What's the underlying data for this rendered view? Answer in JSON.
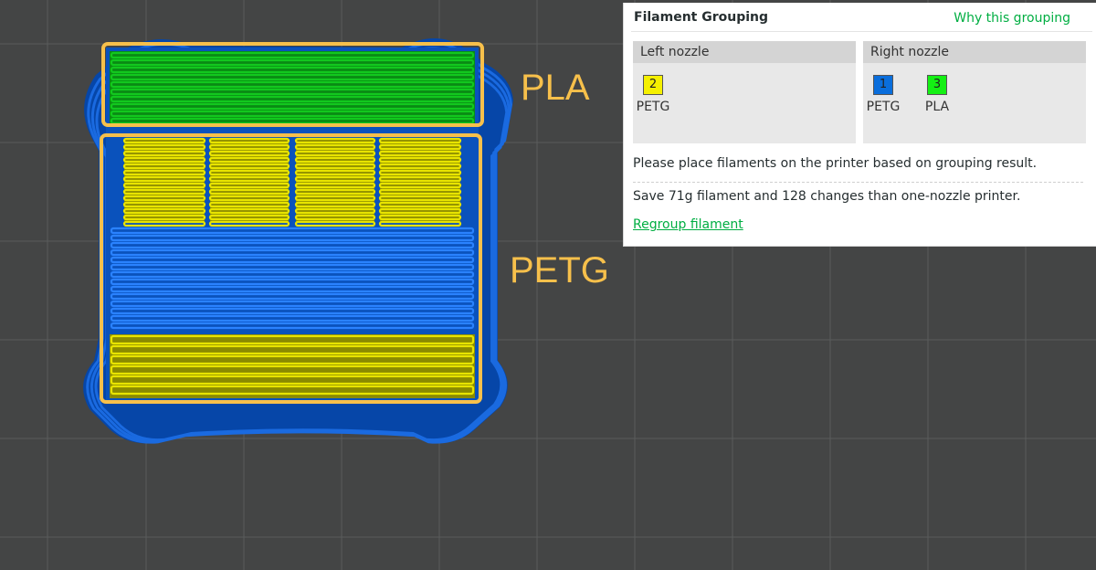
{
  "colors": {
    "background": "#444545",
    "grid": "#5a5c5c",
    "petg_blue": "#0a5ac8",
    "petg_yellow": "#e8e400",
    "pla_green": "#12c81e",
    "annotation": "#f7c04b",
    "accent": "#00ae42"
  },
  "annotations": {
    "pla": "PLA",
    "petg": "PETG"
  },
  "panel": {
    "title": "Filament Grouping",
    "why_link": "Why this grouping",
    "left_nozzle": {
      "label": "Left nozzle",
      "filaments": [
        {
          "number": "2",
          "name": "PETG",
          "color": "#f5f000"
        }
      ]
    },
    "right_nozzle": {
      "label": "Right nozzle",
      "filaments": [
        {
          "number": "1",
          "name": "PETG",
          "color": "#0a6edc"
        },
        {
          "number": "3",
          "name": "PLA",
          "color": "#14f014"
        }
      ]
    },
    "message": "Please place filaments on the printer based on grouping result.",
    "savings": "Save 71g filament and 128 changes than one-nozzle printer.",
    "regroup_link": "Regroup filament"
  }
}
